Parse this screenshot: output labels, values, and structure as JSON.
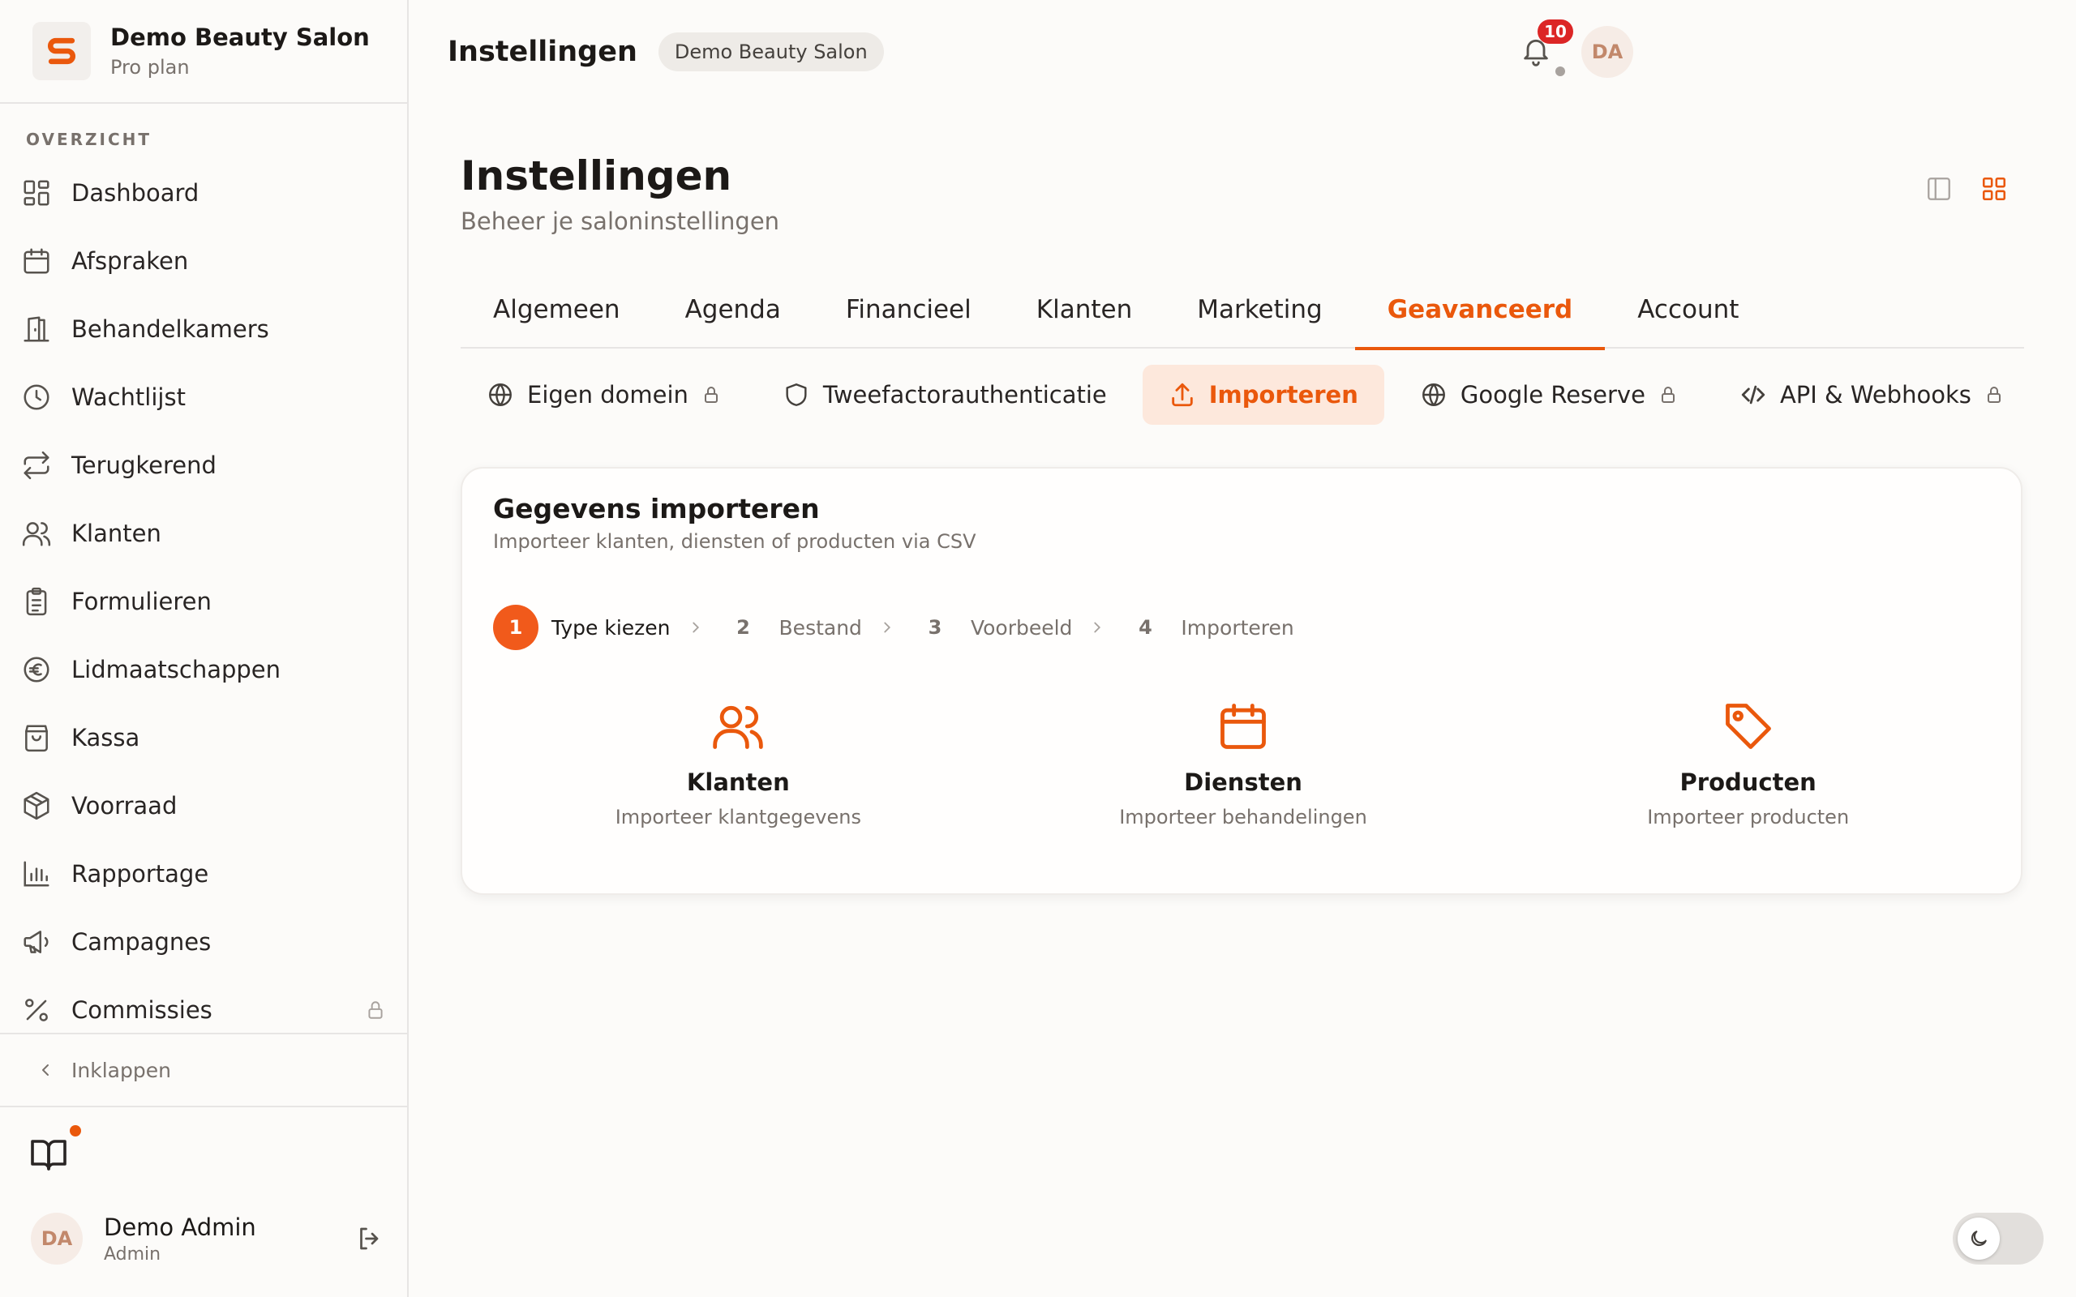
{
  "brand": {
    "name": "Demo Beauty Salon",
    "plan": "Pro plan",
    "accent": "#ea580c"
  },
  "sidebar": {
    "section_label": "OVERZICHT",
    "items": [
      {
        "label": "Dashboard",
        "icon": "dashboard-icon"
      },
      {
        "label": "Afspraken",
        "icon": "calendar-icon"
      },
      {
        "label": "Behandelkamers",
        "icon": "door-icon"
      },
      {
        "label": "Wachtlijst",
        "icon": "clock-icon"
      },
      {
        "label": "Terugkerend",
        "icon": "repeat-icon"
      },
      {
        "label": "Klanten",
        "icon": "users-icon"
      },
      {
        "label": "Formulieren",
        "icon": "clipboard-icon"
      },
      {
        "label": "Lidmaatschappen",
        "icon": "euro-icon"
      },
      {
        "label": "Kassa",
        "icon": "shopping-bag-icon"
      },
      {
        "label": "Voorraad",
        "icon": "package-icon"
      },
      {
        "label": "Rapportage",
        "icon": "bar-chart-icon"
      },
      {
        "label": "Campagnes",
        "icon": "megaphone-icon"
      },
      {
        "label": "Commissies",
        "icon": "percent-icon",
        "locked": true
      }
    ],
    "collapse_label": "Inklappen",
    "user": {
      "initials": "DA",
      "name": "Demo Admin",
      "role": "Admin"
    }
  },
  "header": {
    "title": "Instellingen",
    "salon_badge": "Demo Beauty Salon",
    "notification_count": "10",
    "avatar_initials": "DA"
  },
  "page": {
    "title": "Instellingen",
    "subtitle": "Beheer je saloninstellingen"
  },
  "tabs": [
    {
      "label": "Algemeen"
    },
    {
      "label": "Agenda"
    },
    {
      "label": "Financieel"
    },
    {
      "label": "Klanten"
    },
    {
      "label": "Marketing"
    },
    {
      "label": "Geavanceerd",
      "active": true
    },
    {
      "label": "Account"
    }
  ],
  "subtabs": [
    {
      "label": "Eigen domein",
      "icon": "globe-icon",
      "locked": true
    },
    {
      "label": "Tweefactorauthenticatie",
      "icon": "shield-icon",
      "locked": false
    },
    {
      "label": "Importeren",
      "icon": "upload-icon",
      "locked": false,
      "active": true
    },
    {
      "label": "Google Reserve",
      "icon": "globe-icon",
      "locked": true
    },
    {
      "label": "API & Webhooks",
      "icon": "code-icon",
      "locked": true
    }
  ],
  "import_card": {
    "title": "Gegevens importeren",
    "subtitle": "Importeer klanten, diensten of producten via CSV",
    "steps": [
      {
        "number": "1",
        "label": "Type kiezen",
        "active": true
      },
      {
        "number": "2",
        "label": "Bestand"
      },
      {
        "number": "3",
        "label": "Voorbeeld"
      },
      {
        "number": "4",
        "label": "Importeren"
      }
    ],
    "options": [
      {
        "title": "Klanten",
        "description": "Importeer klantgegevens",
        "icon": "users-icon"
      },
      {
        "title": "Diensten",
        "description": "Importeer behandelingen",
        "icon": "calendar-icon"
      },
      {
        "title": "Producten",
        "description": "Importeer producten",
        "icon": "tag-icon"
      }
    ]
  }
}
